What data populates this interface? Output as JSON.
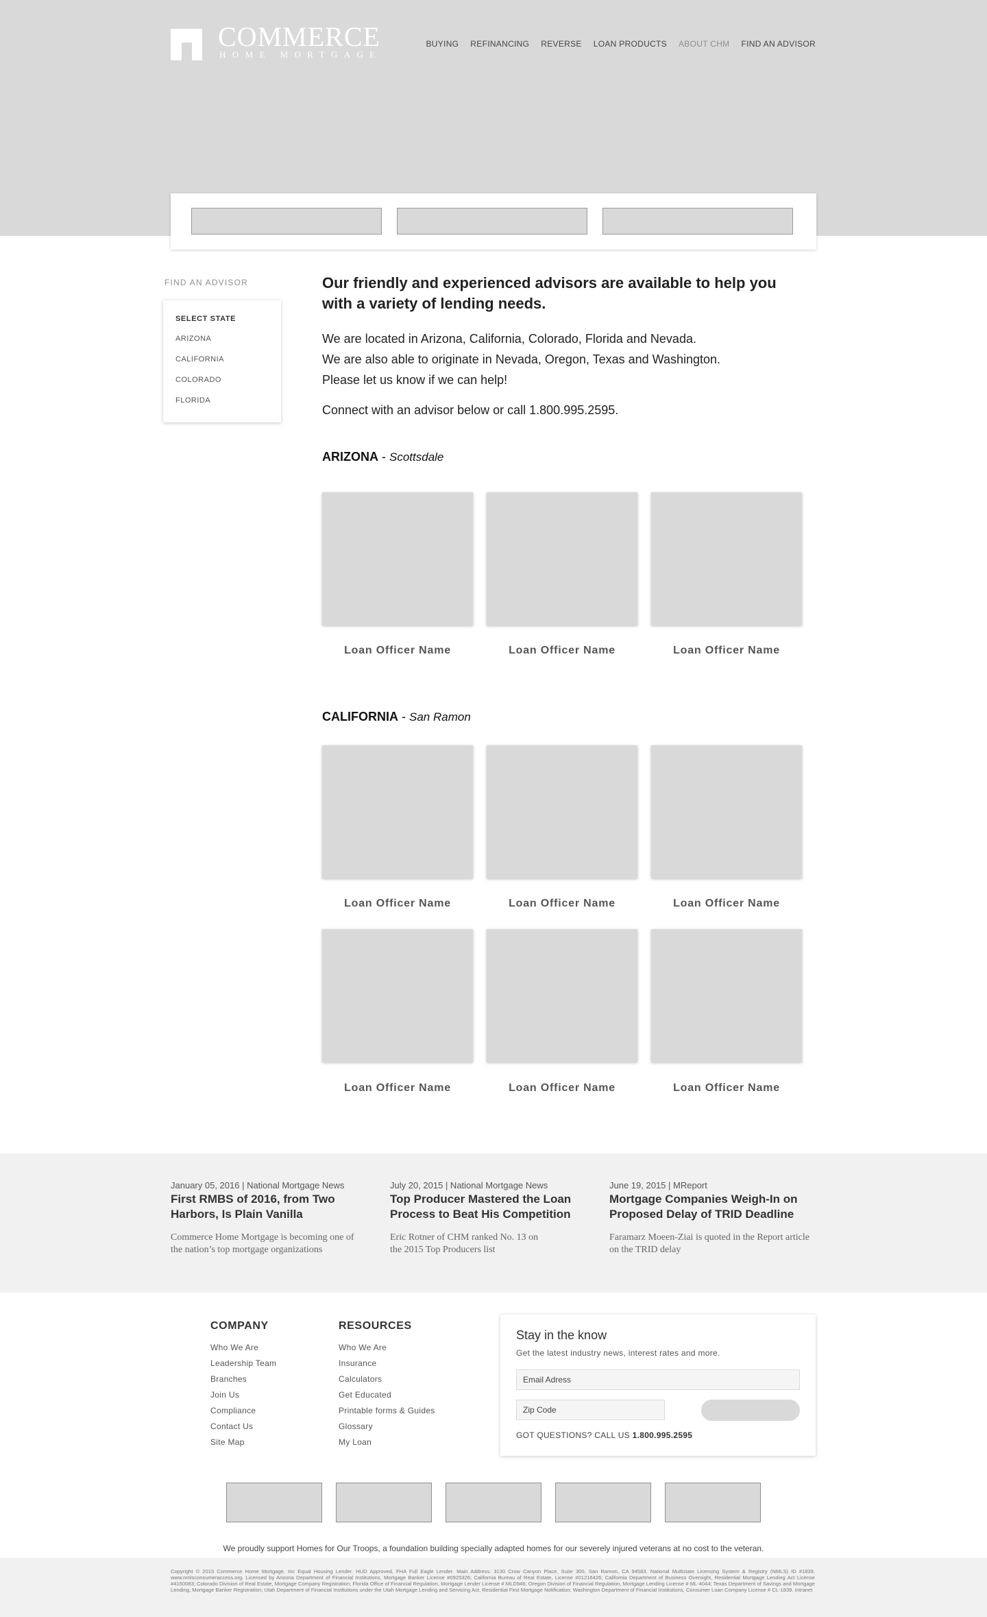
{
  "brand": {
    "name": "COMMERCE",
    "tagline": "HOME MORTGAGE"
  },
  "nav": [
    {
      "label": "BUYING"
    },
    {
      "label": "REFINANCING"
    },
    {
      "label": "REVERSE"
    },
    {
      "label": "LOAN PRODUCTS"
    },
    {
      "label": "ABOUT CHM",
      "active": true
    },
    {
      "label": "FIND AN ADVISOR"
    }
  ],
  "sidebar": {
    "title": "FIND AN ADVISOR",
    "select_label": "SELECT STATE",
    "states": [
      "ARIZONA",
      "CALIFORNIA",
      "COLORADO",
      "FLORIDA"
    ]
  },
  "intro": {
    "heading": "Our friendly and experienced advisors are available to help you with a variety of lending needs.",
    "line1": "We are located in Arizona, California, Colorado, Florida and Nevada.",
    "line2": "We are also able to originate in Nevada, Oregon, Texas and Washington.",
    "line3": "Please let us know if we can help!",
    "line4": "Connect with an advisor below or call 1.800.995.2595."
  },
  "regions": [
    {
      "state": "ARIZONA",
      "separator": " - ",
      "city": "Scottsdale",
      "officers": [
        "Loan Officer Name",
        "Loan Officer Name",
        "Loan Officer Name"
      ]
    },
    {
      "state": "CALIFORNIA",
      "separator": " - ",
      "city": "San Ramon",
      "officers": [
        "Loan Officer Name",
        "Loan Officer Name",
        "Loan Officer Name",
        "Loan Officer Name",
        "Loan Officer Name",
        "Loan Officer Name"
      ]
    }
  ],
  "news": [
    {
      "date": "January 05, 2016 | National Mortgage News",
      "title": "First RMBS of 2016, from Two Harbors, Is Plain Vanilla",
      "desc": "Commerce Home Mortgage is becoming one of the nation’s top mortgage organizations"
    },
    {
      "date": "July 20, 2015 | National Mortgage News",
      "title": "Top Producer Mastered the Loan Process to Beat His Competition",
      "desc": "Eric Rotner of CHM ranked No. 13 on the 2015 Top Producers list"
    },
    {
      "date": "June 19, 2015 | MReport",
      "title": "Mortgage Companies Weigh-In on Proposed Delay of TRID Deadline",
      "desc": "Faramarz Moeen-Ziai is quoted in the Report article on the TRID delay"
    }
  ],
  "footer": {
    "company": {
      "title": "COMPANY",
      "links": [
        "Who We Are",
        "Leadership Team",
        "Branches",
        "Join Us",
        "Compliance",
        "Contact Us",
        "Site Map"
      ]
    },
    "resources": {
      "title": "RESOURCES",
      "links": [
        "Who We Are",
        "Insurance",
        "Calculators",
        "Get Educated",
        "Printable forms & Guides",
        "Glossary",
        "My Loan"
      ]
    },
    "newsletter": {
      "title": "Stay in the know",
      "subtitle": "Get the latest industry news, interest rates and more.",
      "email_placeholder": "Email Adress",
      "zip_placeholder": "Zip Code",
      "questions": "GOT QUESTIONS? CALL US",
      "phone": "1.800.995.2595"
    },
    "troops": "We proudly support Homes for Our Troops, a foundation building specially adapted homes for our severely injured veterans at no cost to the veteran.",
    "legal": "Copyright © 2015 Commerce Home Mortgage, Inc Equal Housing Lender. HUD Approved, FHA Full Eagle Lender. Main Address: 3130 Crow Canyon Place, Suite 300, San Ramon, CA 94583. National Multistate Licensing System & Registry (NMLS) ID #1839, www.nmlsconsumeraccess.org. Licensed by Arizona Department of Financial Institutions, Mortgage Banker License #0925326; California Bureau of Real Estate, License #01216426; California Department of Business Oversight, Residential Mortgage Lending Act License #4150083; Colorado Division of Real Estate, Mortgage Company Registration; Florida Office of Financial Regulation, Mortgage Lender License # MLD946; Oregon Division of Financial Regulation, Mortgage Lending License # ML-4044; Texas Department of Savings and Mortgage Lending, Mortgage Banker Registration; Utah Department of Financial Institutions under the Utah Mortgage Lending and Servicing Act, Residential First Mortgage Notification; Washington Department of Financial Institutions, Consumer Loan Company License # CL-1839. Intranet"
  },
  "colors": {
    "placeholder_gray": "#d9d9d9",
    "band_gray": "#f1f1f1",
    "nav_active": "#8e8e8e"
  }
}
